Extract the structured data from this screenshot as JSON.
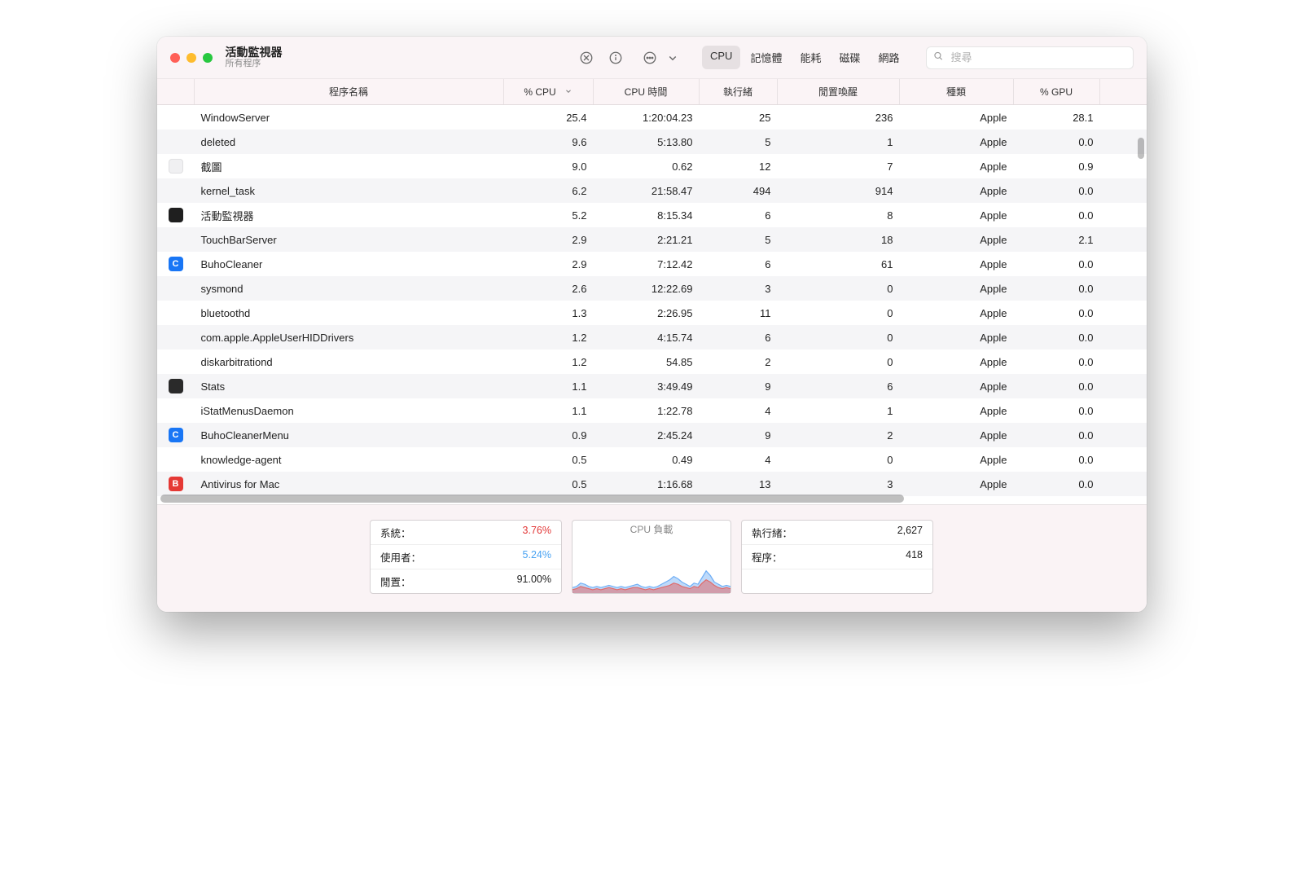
{
  "header": {
    "title": "活動監視器",
    "subtitle": "所有程序"
  },
  "tabs": [
    "CPU",
    "記憶體",
    "能耗",
    "磁碟",
    "網路"
  ],
  "active_tab": "CPU",
  "search": {
    "placeholder": "搜尋"
  },
  "columns": [
    "程序名稱",
    "% CPU",
    "CPU 時間",
    "執行緒",
    "閒置喚醒",
    "種類",
    "% GPU"
  ],
  "sort_column": "% CPU",
  "rows": [
    {
      "icon": "",
      "name": "WindowServer",
      "cpu": "25.4",
      "time": "1:20:04.23",
      "threads": "25",
      "idlew": "236",
      "kind": "Apple",
      "gpu": "28.1"
    },
    {
      "icon": "",
      "name": "deleted",
      "cpu": "9.6",
      "time": "5:13.80",
      "threads": "5",
      "idlew": "1",
      "kind": "Apple",
      "gpu": "0.0"
    },
    {
      "icon": "screenshot",
      "name": "截圖",
      "cpu": "9.0",
      "time": "0.62",
      "threads": "12",
      "idlew": "7",
      "kind": "Apple",
      "gpu": "0.9"
    },
    {
      "icon": "",
      "name": "kernel_task",
      "cpu": "6.2",
      "time": "21:58.47",
      "threads": "494",
      "idlew": "914",
      "kind": "Apple",
      "gpu": "0.0"
    },
    {
      "icon": "activity",
      "name": "活動監視器",
      "cpu": "5.2",
      "time": "8:15.34",
      "threads": "6",
      "idlew": "8",
      "kind": "Apple",
      "gpu": "0.0"
    },
    {
      "icon": "",
      "name": "TouchBarServer",
      "cpu": "2.9",
      "time": "2:21.21",
      "threads": "5",
      "idlew": "18",
      "kind": "Apple",
      "gpu": "2.1"
    },
    {
      "icon": "buho",
      "name": "BuhoCleaner",
      "cpu": "2.9",
      "time": "7:12.42",
      "threads": "6",
      "idlew": "61",
      "kind": "Apple",
      "gpu": "0.0"
    },
    {
      "icon": "",
      "name": "sysmond",
      "cpu": "2.6",
      "time": "12:22.69",
      "threads": "3",
      "idlew": "0",
      "kind": "Apple",
      "gpu": "0.0"
    },
    {
      "icon": "",
      "name": "bluetoothd",
      "cpu": "1.3",
      "time": "2:26.95",
      "threads": "11",
      "idlew": "0",
      "kind": "Apple",
      "gpu": "0.0"
    },
    {
      "icon": "",
      "name": "com.apple.AppleUserHIDDrivers",
      "cpu": "1.2",
      "time": "4:15.74",
      "threads": "6",
      "idlew": "0",
      "kind": "Apple",
      "gpu": "0.0"
    },
    {
      "icon": "",
      "name": "diskarbitrationd",
      "cpu": "1.2",
      "time": "54.85",
      "threads": "2",
      "idlew": "0",
      "kind": "Apple",
      "gpu": "0.0"
    },
    {
      "icon": "stats",
      "name": "Stats",
      "cpu": "1.1",
      "time": "3:49.49",
      "threads": "9",
      "idlew": "6",
      "kind": "Apple",
      "gpu": "0.0"
    },
    {
      "icon": "",
      "name": "iStatMenusDaemon",
      "cpu": "1.1",
      "time": "1:22.78",
      "threads": "4",
      "idlew": "1",
      "kind": "Apple",
      "gpu": "0.0"
    },
    {
      "icon": "buho",
      "name": "BuhoCleanerMenu",
      "cpu": "0.9",
      "time": "2:45.24",
      "threads": "9",
      "idlew": "2",
      "kind": "Apple",
      "gpu": "0.0"
    },
    {
      "icon": "",
      "name": "knowledge-agent",
      "cpu": "0.5",
      "time": "0.49",
      "threads": "4",
      "idlew": "0",
      "kind": "Apple",
      "gpu": "0.0"
    },
    {
      "icon": "antiv",
      "name": "Antivirus for Mac",
      "cpu": "0.5",
      "time": "1:16.68",
      "threads": "13",
      "idlew": "3",
      "kind": "Apple",
      "gpu": "0.0"
    }
  ],
  "footer": {
    "system_label": "系統：",
    "system_value": "3.76%",
    "user_label": "使用者：",
    "user_value": "5.24%",
    "idle_label": "閒置：",
    "idle_value": "91.00%",
    "chart_title": "CPU 負載",
    "threads_label": "執行緒：",
    "threads_value": "2,627",
    "procs_label": "程序：",
    "procs_value": "418"
  },
  "chart_data": {
    "type": "area",
    "title": "CPU 負載",
    "xlabel": "",
    "ylabel": "",
    "ylim": [
      0,
      50
    ],
    "x": [
      0,
      1,
      2,
      3,
      4,
      5,
      6,
      7,
      8,
      9,
      10,
      11,
      12,
      13,
      14,
      15,
      16,
      17,
      18,
      19,
      20,
      21,
      22,
      23,
      24,
      25,
      26,
      27,
      28,
      29,
      30,
      31,
      32,
      33,
      34,
      35,
      36,
      37,
      38,
      39
    ],
    "series": [
      {
        "name": "系統",
        "color": "#e06a6a",
        "values": [
          3,
          4,
          6,
          5,
          4,
          3,
          4,
          3,
          4,
          5,
          4,
          3,
          4,
          3,
          4,
          5,
          5,
          4,
          3,
          4,
          3,
          4,
          5,
          6,
          7,
          9,
          8,
          6,
          5,
          4,
          6,
          5,
          9,
          12,
          10,
          7,
          5,
          4,
          5,
          4
        ]
      },
      {
        "name": "使用者",
        "color": "#6faef5",
        "values": [
          5,
          6,
          9,
          8,
          6,
          5,
          6,
          5,
          6,
          7,
          6,
          5,
          6,
          5,
          6,
          7,
          8,
          6,
          5,
          6,
          5,
          6,
          8,
          10,
          12,
          15,
          13,
          10,
          8,
          6,
          9,
          8,
          14,
          20,
          16,
          10,
          8,
          6,
          7,
          6
        ]
      }
    ]
  }
}
